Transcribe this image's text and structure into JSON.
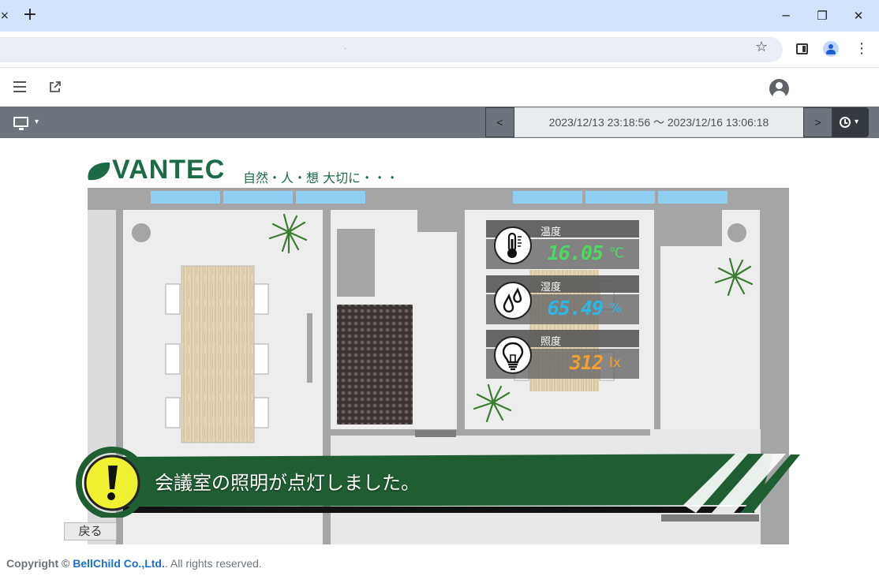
{
  "browser": {
    "tab_close": "×",
    "new_tab": "+",
    "omnibox_text": "·",
    "window_controls": {
      "minimize": "─",
      "restore": "❐",
      "close": "✕"
    },
    "icons": [
      "star-icon",
      "side-panel-icon",
      "profile-icon",
      "kebab-menu-icon"
    ]
  },
  "header": {
    "icons": [
      "menu-icon",
      "external-link-icon",
      "user-icon"
    ]
  },
  "controls": {
    "prev_label": "<",
    "date_range": "2023/12/13 23:18:56 〜 2023/12/16 13:06:18",
    "next_label": ">",
    "caret": "▾"
  },
  "logo": {
    "name": "VANTEC",
    "tagline": "自然・人・想 大切に・・・"
  },
  "sensors": [
    {
      "label": "温度",
      "value": "16.05",
      "unit": "℃",
      "icon": "thermometer-icon",
      "color": "#4cd964"
    },
    {
      "label": "湿度",
      "value": "65.49",
      "unit": "%",
      "icon": "droplets-icon",
      "color": "#2bb8e8"
    },
    {
      "label": "照度",
      "value": "312",
      "unit": "lx",
      "icon": "lightbulb-icon",
      "color": "#f0a030"
    }
  ],
  "alert": {
    "message": "会議室の照明が点灯しました。",
    "icon": "exclamation-icon"
  },
  "back_label": "戻る",
  "footer": {
    "prefix": "Copyright ©",
    "company": "BellChild Co.,Ltd.",
    "suffix": ". All rights reserved."
  }
}
